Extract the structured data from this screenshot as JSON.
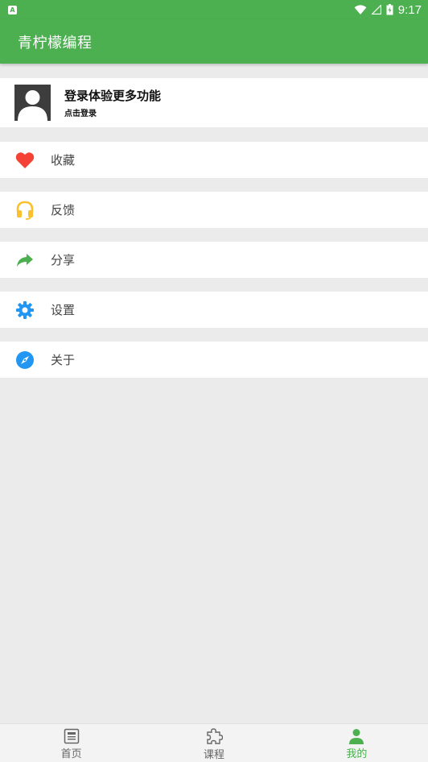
{
  "status_bar": {
    "notification_icon": "A",
    "time": "9:17"
  },
  "app_bar": {
    "title": "青柠檬编程"
  },
  "login": {
    "title": "登录体验更多功能",
    "subtitle": "点击登录"
  },
  "menu": {
    "items": [
      {
        "label": "收藏",
        "icon": "heart-icon",
        "color": "#f44336"
      },
      {
        "label": "反馈",
        "icon": "headphones-icon",
        "color": "#fbc02d"
      },
      {
        "label": "分享",
        "icon": "share-arrow-icon",
        "color": "#4caf50"
      },
      {
        "label": "设置",
        "icon": "gear-icon",
        "color": "#2196f3"
      },
      {
        "label": "关于",
        "icon": "compass-icon",
        "color": "#2196f3"
      }
    ]
  },
  "bottom_nav": {
    "tabs": [
      {
        "label": "首页",
        "icon": "newspaper-icon",
        "active": false
      },
      {
        "label": "课程",
        "icon": "puzzle-icon",
        "active": false
      },
      {
        "label": "我的",
        "icon": "person-icon",
        "active": true
      }
    ]
  },
  "colors": {
    "primary": "#4caf50",
    "background": "#ebebeb"
  }
}
